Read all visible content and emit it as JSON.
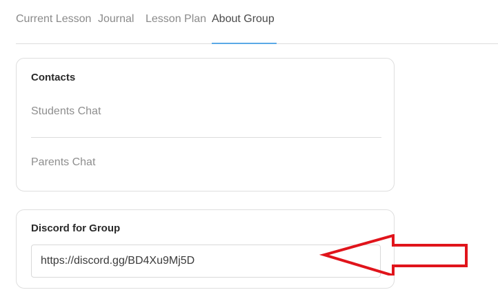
{
  "tabs": [
    {
      "label": "Current Lesson"
    },
    {
      "label": "Journal"
    },
    {
      "label": "Lesson Plan"
    },
    {
      "label": "About Group"
    }
  ],
  "active_tab": "About Group",
  "contacts": {
    "title": "Contacts",
    "items": [
      {
        "label": "Students Chat"
      },
      {
        "label": "Parents Chat"
      }
    ]
  },
  "discord": {
    "title": "Discord for Group",
    "link": "https://discord.gg/BD4Xu9Mj5D"
  },
  "colors": {
    "active_underline": "#5aa9e6",
    "annotation_arrow": "#e0141b"
  },
  "annotation": {
    "icon": "red-arrow-left-icon"
  }
}
